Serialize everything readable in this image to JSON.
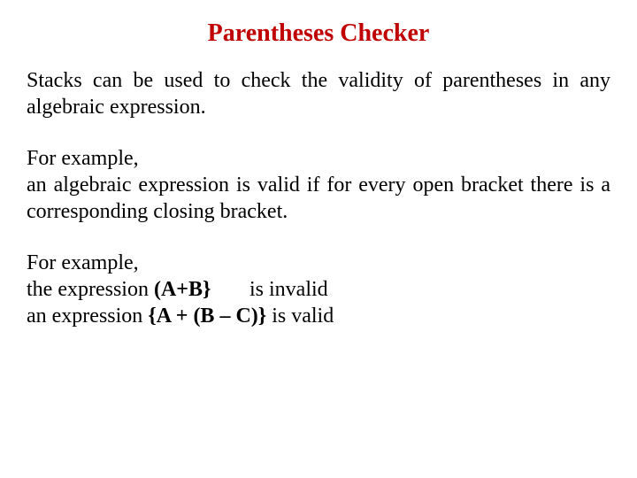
{
  "colors": {
    "title": "#C00000"
  },
  "title": "Parentheses Checker",
  "intro": "Stacks can be used to check the validity of parentheses in any algebraic expression.",
  "example1_label": "For example,",
  "example1_text": "an algebraic expression is valid if for every open bracket there is a corresponding closing bracket.",
  "example2_label": "For example,",
  "line1_prefix": "the expression ",
  "line1_expr": "(A+B}",
  "line1_suffix": "is invalid",
  "line2_prefix": "an expression ",
  "line2_expr": "{A + (B – C)}",
  "line2_suffix": " is valid"
}
